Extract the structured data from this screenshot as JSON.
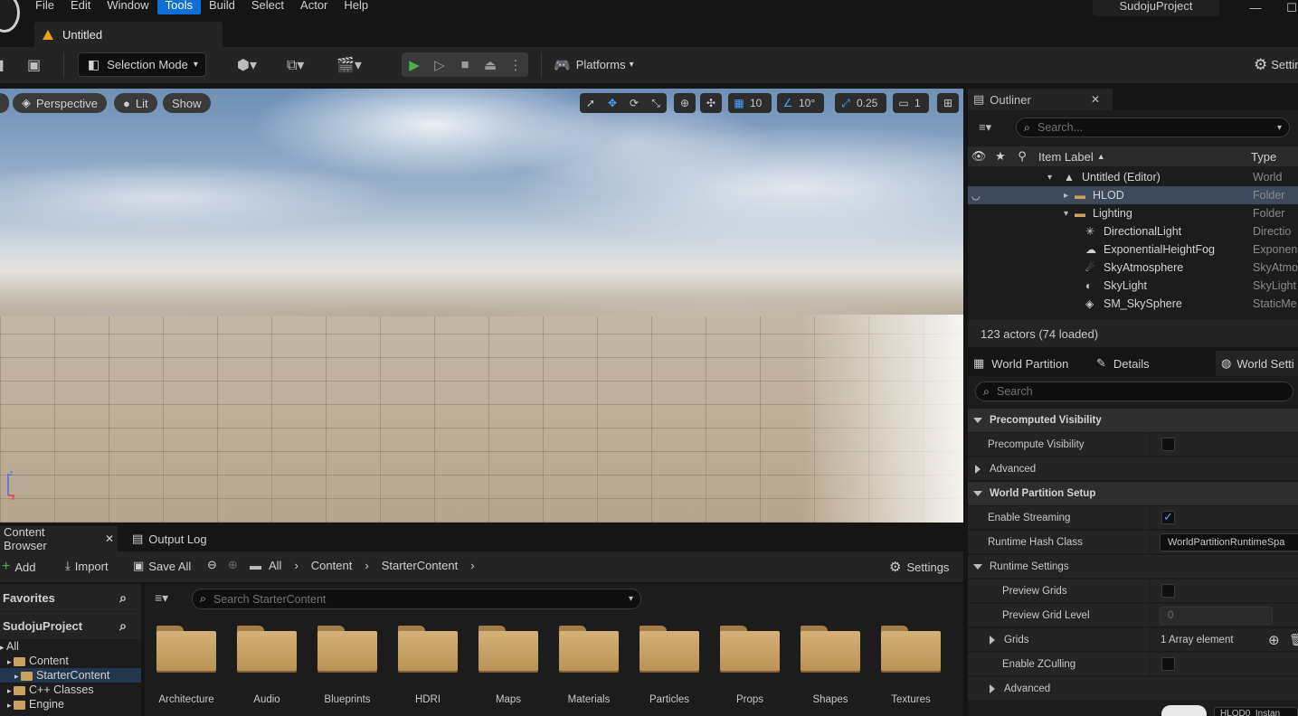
{
  "menu": [
    "File",
    "Edit",
    "Window",
    "Tools",
    "Build",
    "Select",
    "Actor",
    "Help"
  ],
  "menu_active": "Tools",
  "project_name": "SudojuProject",
  "doc_tab": "Untitled",
  "toolbar": {
    "selection_mode": "Selection Mode",
    "platforms": "Platforms",
    "settings": "Settings"
  },
  "viewport": {
    "perspective": "Perspective",
    "lit": "Lit",
    "show": "Show",
    "grid_snap": "10",
    "rotation_snap": "10°",
    "scale_snap": "0.25",
    "camera_speed": "1"
  },
  "content_browser": {
    "tab": "Content Browser",
    "output_log_tab": "Output Log",
    "add": "Add",
    "import": "Import",
    "save_all": "Save All",
    "breadcrumbs": [
      "All",
      "Content",
      "StarterContent"
    ],
    "settings": "Settings",
    "favorites": "Favorites",
    "project": "SudojuProject",
    "search_placeholder": "Search StarterContent",
    "tree": [
      {
        "label": "All",
        "indent": 0
      },
      {
        "label": "Content",
        "indent": 1
      },
      {
        "label": "StarterContent",
        "indent": 2,
        "selected": true
      },
      {
        "label": "C++ Classes",
        "indent": 1
      },
      {
        "label": "Engine",
        "indent": 1
      }
    ],
    "folders": [
      "Architecture",
      "Audio",
      "Blueprints",
      "HDRI",
      "Maps",
      "Materials",
      "Particles",
      "Props",
      "Shapes",
      "Textures"
    ]
  },
  "outliner": {
    "tab": "Outliner",
    "search_placeholder": "Search...",
    "col_label": "Item Label",
    "col_type": "Type",
    "rows": [
      {
        "label": "Untitled (Editor)",
        "type": "World",
        "indent": 0
      },
      {
        "label": "HLOD",
        "type": "Folder",
        "indent": 1,
        "selected": true
      },
      {
        "label": "Lighting",
        "type": "Folder",
        "indent": 1
      },
      {
        "label": "DirectionalLight",
        "type": "Directio",
        "indent": 2
      },
      {
        "label": "ExponentialHeightFog",
        "type": "Exponen",
        "indent": 2
      },
      {
        "label": "SkyAtmosphere",
        "type": "SkyAtmo",
        "indent": 2
      },
      {
        "label": "SkyLight",
        "type": "SkyLight",
        "indent": 2
      },
      {
        "label": "SM_SkySphere",
        "type": "StaticMe",
        "indent": 2
      }
    ],
    "footer": "123 actors (74 loaded)"
  },
  "details": {
    "tabs": [
      "World Partition",
      "Details",
      "World Setti"
    ],
    "search_placeholder": "Search",
    "sections": {
      "precomputed": "Precomputed Visibility",
      "precompute_visibility": "Precompute Visibility",
      "advanced": "Advanced",
      "wp_setup": "World Partition Setup",
      "enable_streaming": "Enable Streaming",
      "runtime_hash_class": "Runtime Hash Class",
      "runtime_hash_value": "WorldPartitionRuntimeSpa",
      "runtime_settings": "Runtime Settings",
      "preview_grids": "Preview Grids",
      "preview_grid_level": "Preview Grid Level",
      "preview_grid_level_value": "0",
      "grids": "Grids",
      "grids_value": "1 Array element",
      "enable_zculling": "Enable ZCulling",
      "advanced2": "Advanced",
      "hlod_partial": "HLOD0_Instan"
    }
  },
  "colors": {
    "accent": "#0e6fd6",
    "play_green": "#4caf50",
    "folder": "#c9a15c"
  }
}
